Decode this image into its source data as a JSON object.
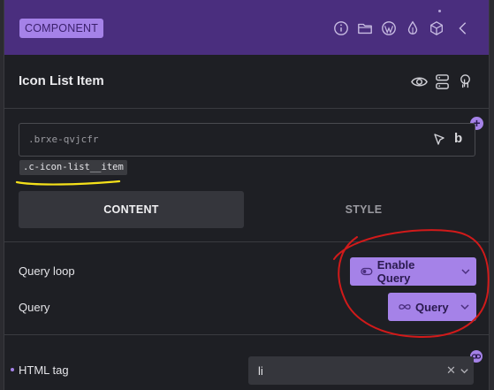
{
  "header": {
    "badge": "COMPONENT",
    "icons": [
      "info-icon",
      "folder-icon",
      "wordpress-icon",
      "drop-icon",
      "cube-icon",
      "chevron-left-icon"
    ]
  },
  "element": {
    "title": "Icon List Item",
    "icons": [
      "eye-icon",
      "structure-icon",
      "touch-icon"
    ]
  },
  "selector": {
    "id_text": ".brxe-qvjcfr",
    "class_chip": ".c-icon-list__item",
    "add_label": "+",
    "bold_label": "b"
  },
  "tabs": [
    {
      "label": "CONTENT",
      "active": true
    },
    {
      "label": "STYLE",
      "active": false
    }
  ],
  "controls": {
    "query_loop_label": "Query loop",
    "enable_query_label": "Enable Query",
    "query_label": "Query",
    "query_button_label": "Query",
    "html_tag_label": "HTML tag",
    "html_tag_value": "li",
    "clear_label": "✕"
  },
  "colors": {
    "accent": "#a582e8",
    "header_bg": "#4a2e7e",
    "panel_bg": "#1e1f24",
    "annotation_red": "#d11a1a",
    "annotation_yellow": "#f5e11a"
  }
}
